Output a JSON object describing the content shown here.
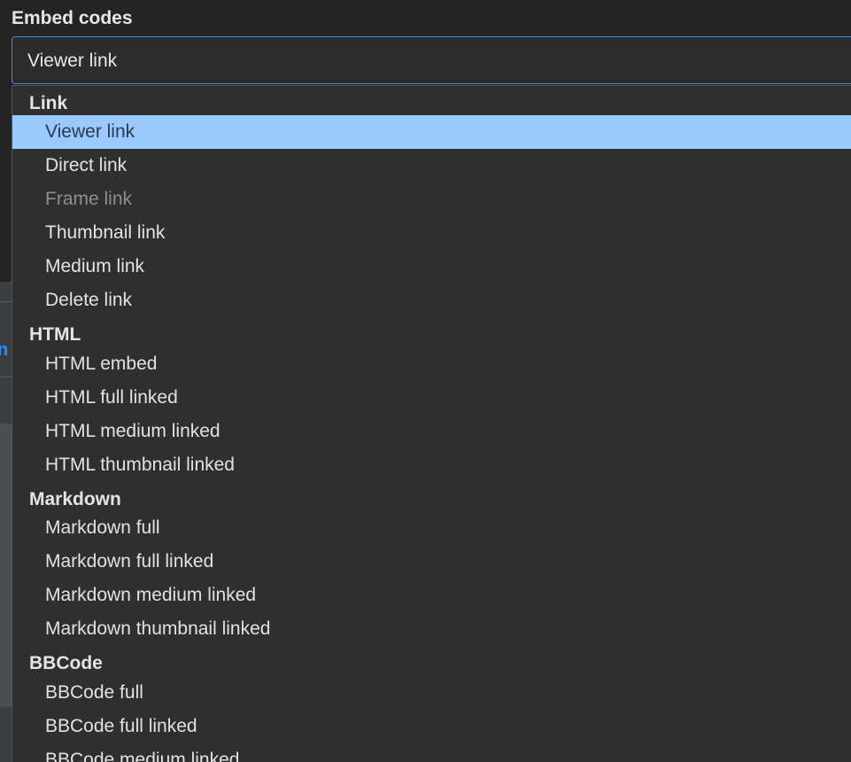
{
  "field": {
    "label": "Embed codes",
    "selected_value": "Viewer link"
  },
  "background": {
    "partial_link_text": "n"
  },
  "colors": {
    "highlight": "#99c9ff",
    "focus_border": "#3d8bfd",
    "dropdown_bg": "#2f2f2f",
    "page_bg": "#232323"
  },
  "dropdown": {
    "groups": [
      {
        "label": "Link",
        "options": [
          {
            "label": "Viewer link",
            "selected": true
          },
          {
            "label": "Direct link"
          },
          {
            "label": "Frame link",
            "disabled": true
          },
          {
            "label": "Thumbnail link"
          },
          {
            "label": "Medium link"
          },
          {
            "label": "Delete link"
          }
        ]
      },
      {
        "label": "HTML",
        "options": [
          {
            "label": "HTML embed"
          },
          {
            "label": "HTML full linked"
          },
          {
            "label": "HTML medium linked"
          },
          {
            "label": "HTML thumbnail linked"
          }
        ]
      },
      {
        "label": "Markdown",
        "options": [
          {
            "label": "Markdown full"
          },
          {
            "label": "Markdown full linked"
          },
          {
            "label": "Markdown medium linked"
          },
          {
            "label": "Markdown thumbnail linked"
          }
        ]
      },
      {
        "label": "BBCode",
        "options": [
          {
            "label": "BBCode full"
          },
          {
            "label": "BBCode full linked"
          },
          {
            "label": "BBCode medium linked"
          }
        ]
      }
    ]
  }
}
